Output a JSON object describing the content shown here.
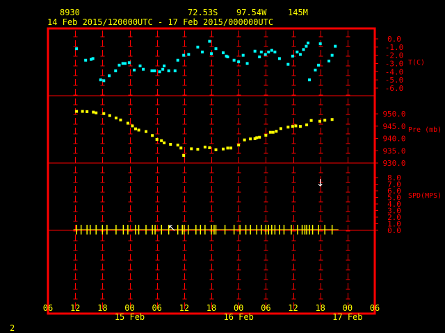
{
  "header": {
    "station_id": "8930",
    "lat": "72.53S",
    "lon": "97.54W",
    "elev": "145M",
    "time_range": "14 Feb 2015/120000UTC - 17 Feb 2015/000000UTC"
  },
  "corner_label": "2",
  "colors": {
    "frame": "#ff0000",
    "tick": "#ff0000",
    "axis_text": "#ffff00",
    "panel_label": "#ff0000",
    "temp": "#00ffff",
    "pres": "#ffff00",
    "wind": "#ffff00",
    "wind_arrow": "#ffffff",
    "bg": "#000000"
  },
  "chart_data": {
    "type": "scatter",
    "x_axis": {
      "unit": "hours since 14 Feb 2015 06 UTC",
      "range": [
        0,
        72
      ],
      "tick_labels": [
        "06",
        "12",
        "18",
        "00",
        "06",
        "12",
        "18",
        "00",
        "06",
        "12",
        "18",
        "00",
        "06"
      ],
      "date_labels": [
        {
          "label": "15 Feb",
          "at_hour": 18
        },
        {
          "label": "16 Feb",
          "at_hour": 42
        },
        {
          "label": "17 Feb",
          "at_hour": 66
        }
      ]
    },
    "panels": [
      {
        "name": "temperature",
        "ylabel": "T(C)",
        "ylim": [
          -6.0,
          0.0
        ],
        "ticks": [
          "0.0",
          "-1.0",
          "-2.0",
          "-3.0",
          "-4.0",
          "-5.0",
          "-6.0"
        ],
        "tick_values": [
          0,
          -1,
          -2,
          -3,
          -4,
          -5,
          -6
        ],
        "x": [
          6.3,
          8.3,
          9.5,
          9.9,
          11.6,
          12.3,
          13.5,
          14.9,
          15.7,
          16.5,
          17.0,
          17.9,
          19.0,
          20.3,
          21.0,
          22.9,
          23.5,
          24.6,
          25.3,
          25.6,
          26.6,
          28.0,
          28.6,
          29.9,
          31.0,
          33.0,
          34.0,
          35.6,
          36.0,
          37.0,
          38.6,
          39.3,
          39.6,
          41.0,
          42.0,
          43.0,
          43.9,
          45.6,
          46.6,
          47.0,
          47.9,
          48.6,
          49.3,
          50.0,
          51.0,
          52.9,
          53.9,
          54.9,
          55.6,
          56.3,
          56.9,
          57.3,
          57.6,
          58.9,
          59.6,
          60.0,
          61.9,
          62.6,
          63.3
        ],
        "y": [
          -1.2,
          -2.6,
          -2.5,
          -2.4,
          -5.0,
          -5.1,
          -4.5,
          -3.9,
          -3.2,
          -3.0,
          -3.0,
          -2.9,
          -3.8,
          -3.3,
          -3.7,
          -3.9,
          -3.9,
          -4.0,
          -3.7,
          -3.3,
          -3.9,
          -3.9,
          -2.6,
          -2.0,
          -1.9,
          -1.0,
          -1.6,
          -0.3,
          -1.8,
          -1.2,
          -1.7,
          -2.1,
          -2.2,
          -2.6,
          -2.8,
          -2.0,
          -3.0,
          -1.5,
          -2.2,
          -1.6,
          -1.9,
          -1.6,
          -1.4,
          -1.6,
          -2.4,
          -3.1,
          -2.1,
          -1.6,
          -1.9,
          -1.3,
          -0.9,
          -0.5,
          -5.0,
          -3.8,
          -3.2,
          -0.6,
          -2.7,
          -2.0,
          -0.9
        ]
      },
      {
        "name": "pressure",
        "ylabel": "Pre (mb)",
        "ylim": [
          930.0,
          952.0
        ],
        "ticks": [
          "950.0",
          "945.0",
          "940.0",
          "935.0",
          "930.0"
        ],
        "tick_values": [
          950,
          945,
          940,
          935,
          930
        ],
        "x": [
          6.3,
          7.6,
          8.6,
          10.0,
          10.6,
          12.3,
          13.6,
          15.0,
          16.0,
          17.6,
          18.6,
          19.3,
          20.0,
          21.6,
          23.0,
          24.0,
          25.0,
          25.6,
          27.0,
          28.6,
          29.3,
          29.9,
          31.6,
          33.0,
          34.6,
          35.6,
          37.0,
          38.6,
          39.6,
          40.3,
          42.0,
          43.3,
          44.6,
          45.6,
          46.0,
          46.6,
          48.0,
          49.0,
          49.6,
          50.3,
          51.3,
          52.9,
          53.9,
          54.6,
          55.6,
          57.0,
          58.0,
          59.9,
          61.0,
          62.6
        ],
        "y": [
          951.0,
          951.0,
          950.9,
          950.7,
          950.4,
          950.1,
          949.3,
          948.3,
          947.5,
          946.2,
          945.1,
          943.9,
          943.4,
          942.8,
          941.2,
          939.6,
          939.1,
          938.2,
          937.6,
          937.3,
          936.1,
          933.1,
          935.8,
          935.6,
          936.5,
          936.2,
          935.4,
          935.7,
          936.1,
          936.1,
          937.3,
          939.4,
          939.8,
          939.9,
          940.3,
          940.5,
          941.3,
          942.5,
          942.5,
          942.9,
          944.0,
          944.6,
          944.9,
          945.1,
          944.9,
          945.5,
          947.3,
          947.0,
          947.4,
          947.7,
          949.5,
          950.1,
          950.5,
          951.3
        ]
      },
      {
        "name": "wind_speed",
        "ylabel": "SPD(MPS)",
        "ylim": [
          0.0,
          8.0
        ],
        "ticks": [
          "8.0",
          "7.0",
          "6.0",
          "5.0",
          "4.0",
          "3.0",
          "2.0",
          "1.0",
          "0.0"
        ],
        "tick_values": [
          8,
          7,
          6,
          5,
          4,
          3,
          2,
          1,
          0
        ],
        "x": [
          6.3,
          7.3,
          8.6,
          9.3,
          10.6,
          12.0,
          13.0,
          15.0,
          16.6,
          17.6,
          19.3,
          20.0,
          21.6,
          23.0,
          23.6,
          25.0,
          26.6,
          28.6,
          29.6,
          30.0,
          30.9,
          32.6,
          33.6,
          34.6,
          36.0,
          36.6,
          37.0,
          39.0,
          41.0,
          42.3,
          43.6,
          44.6,
          46.0,
          47.0,
          48.0,
          48.6,
          49.3,
          50.0,
          51.0,
          52.0,
          53.6,
          55.0,
          56.0,
          56.6,
          57.0,
          57.6,
          58.3,
          59.6,
          61.0,
          62.6
        ],
        "y": [
          0.1,
          0.1,
          0.1,
          0.1,
          0.1,
          0.1,
          0.1,
          0.1,
          0.1,
          0.1,
          0.1,
          0.1,
          0.1,
          0.1,
          0.1,
          0.1,
          0.1,
          0.1,
          0.1,
          0.1,
          0.1,
          0.1,
          0.1,
          0.1,
          0.1,
          0.1,
          0.1,
          0.1,
          0.1,
          0.1,
          0.1,
          0.1,
          0.1,
          0.1,
          0.1,
          0.1,
          0.1,
          0.1,
          0.1,
          0.1,
          0.1,
          0.1,
          0.1,
          0.1,
          0.1,
          0.1,
          0.1,
          0.1,
          0.1,
          0.1
        ],
        "arrows": [
          {
            "x": 27.3,
            "y": 0.4,
            "glyph": "↖"
          },
          {
            "x": 60.0,
            "y": 7.2,
            "glyph": "↓"
          }
        ]
      }
    ]
  }
}
